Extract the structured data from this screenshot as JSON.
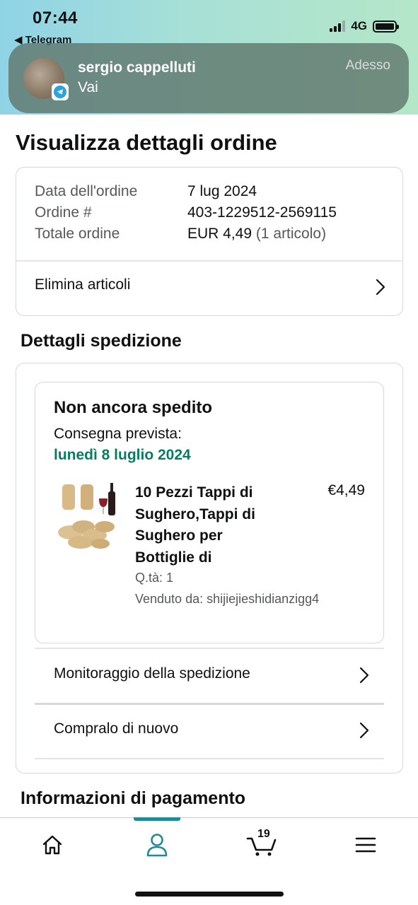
{
  "status_bar": {
    "time": "07:44",
    "back_app": "◀ Telegram",
    "network": "4G"
  },
  "notification": {
    "sender": "sergio cappelluti",
    "message": "Vai",
    "time": "Adesso",
    "app_icon": "telegram-icon"
  },
  "page": {
    "title": "Visualizza dettagli ordine"
  },
  "order": {
    "rows": [
      {
        "label": "Data dell'ordine",
        "value": "7 lug 2024",
        "suffix": ""
      },
      {
        "label": "Ordine #",
        "value": "403-1229512-2569115",
        "suffix": ""
      },
      {
        "label": "Totale ordine",
        "value": "EUR 4,49",
        "suffix": " (1 articolo)"
      }
    ],
    "delete_items_label": "Elimina articoli"
  },
  "shipment": {
    "section_title": "Dettagli spedizione",
    "status": "Non ancora spedito",
    "expected_label": "Consegna prevista:",
    "expected_date": "lunedì 8 luglio 2024",
    "expected_date_color": "#067D62",
    "product": {
      "title": "10 Pezzi Tappi di Sughero,Tappi di Sughero per Bottiglie di",
      "price": "€4,49",
      "quantity": "Q.tà: 1",
      "seller": "Venduto da: shijiejieshidianzigg4"
    },
    "track_label": "Monitoraggio della spedizione",
    "buy_again_label": "Compralo di nuovo"
  },
  "payment": {
    "section_title": "Informazioni di pagamento"
  },
  "bottom_nav": {
    "items": [
      {
        "name": "home",
        "icon": "home-icon"
      },
      {
        "name": "account",
        "icon": "person-icon",
        "active": true
      },
      {
        "name": "cart",
        "icon": "cart-icon"
      },
      {
        "name": "menu",
        "icon": "hamburger-menu-icon"
      }
    ],
    "cart_count": "19",
    "accent_color": "#1F8A9A"
  }
}
